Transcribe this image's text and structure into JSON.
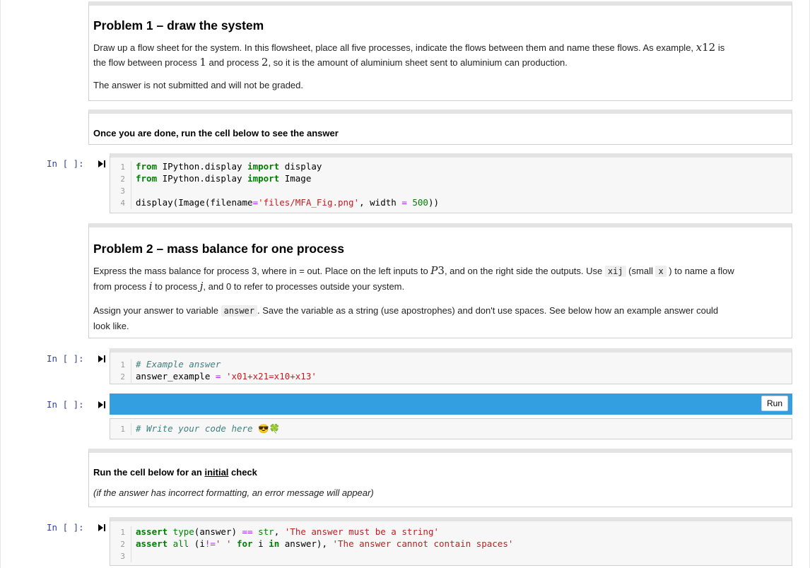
{
  "problem1": {
    "title": "Problem 1 – draw the system",
    "p1_a": "Draw up a flow sheet for the system. In this flowsheet, place all five processes, indicate the flows between them and name these flows. As example, ",
    "p1_var": "x",
    "p1_sub": "12",
    "p1_b": " is",
    "p1_c": "the flow between process ",
    "p1_n1": "1",
    "p1_d": " and process ",
    "p1_n2": "2",
    "p1_e": ", so it is the amount of aluminium sheet sent to aluminium can production.",
    "p2": "The answer is not submitted and will not be graded."
  },
  "done_cell": {
    "text": "Once you are done, run the cell below to see the answer"
  },
  "prompt": "In [ ]:",
  "code1": {
    "lines": [
      {
        "n": "1",
        "kw1": "from",
        "mod": " IPython.display ",
        "kw2": "import",
        "name": " display"
      },
      {
        "n": "2",
        "kw1": "from",
        "mod": " IPython.display ",
        "kw2": "import",
        "name": " Image"
      },
      {
        "n": "3"
      },
      {
        "n": "4",
        "a": "display(Image(filename",
        "eq": "=",
        "s": "'files/MFA_Fig.png'",
        "b": ", width ",
        "eq2": "=",
        "num": " 500",
        "c": "))"
      }
    ]
  },
  "problem2": {
    "title": "Problem 2 – mass balance for one process",
    "p1_a": "Express the mass balance for process 3, where in = out. Place on the left inputs to ",
    "p1_p": "P",
    "p1_p3": "3",
    "p1_b": ", and on the right side the outputs. Use ",
    "code_xij": "xij",
    "p1_c": " (small ",
    "code_x": "x",
    "p1_d": " ) to name a flow",
    "p1_e": "from process ",
    "p1_i": "i",
    "p1_f": " to process ",
    "p1_j": "j",
    "p1_g": ", and 0 to refer to processes outside your system.",
    "p2_a": "Assign your answer to variable ",
    "code_answer": "answer",
    "p2_b": ". Save the variable as a string (use apostrophes) and don't use spaces. See below how an example answer could",
    "p2_c": "look like."
  },
  "code2": {
    "l1_n": "1",
    "l1_c": "# Example answer",
    "l2_n": "2",
    "l2_a": "answer_example ",
    "l2_eq": "=",
    "l2_s": " 'x01+x21=x10+x13'"
  },
  "code3": {
    "run_label": "Run",
    "l1_n": "1",
    "l1_c": "# Write your code here",
    "emoji": "😎🍀"
  },
  "check_cell": {
    "t_a": "Run the cell below for an ",
    "t_u": "initial",
    "t_b": " check",
    "italic": "(if the answer has incorrect formatting, an error message will appear)"
  },
  "code4": {
    "l1_n": "1",
    "l1_kw": "assert",
    "l1_bi": " type",
    "l1_a": "(answer) ",
    "l1_op": "==",
    "l1_bi2": " str",
    "l1_b": ", ",
    "l1_s": "'The answer must be a string'",
    "l2_n": "2",
    "l2_kw": "assert",
    "l2_bi": " all",
    "l2_a": " (i",
    "l2_op": "!=",
    "l2_s": "' '",
    "l2_kw2": " for",
    "l2_b": " i ",
    "l2_kw3": "in",
    "l2_c": " answer), ",
    "l2_s2": "'The answer cannot contain spaces'",
    "l3_n": "3"
  }
}
